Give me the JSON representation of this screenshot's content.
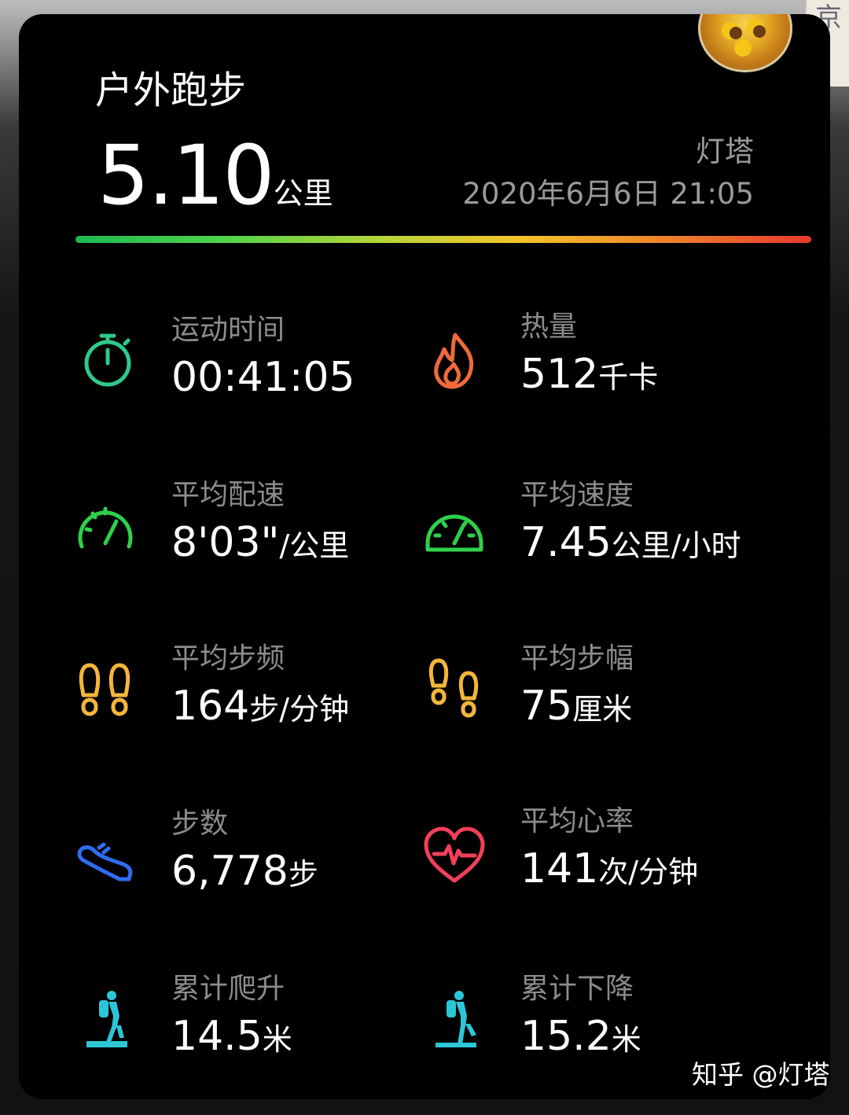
{
  "header": {
    "title": "户外跑步",
    "distance_value": "5.10",
    "distance_unit": "公里",
    "location": "灯塔",
    "datetime": "2020年6月6日 21:05"
  },
  "stats": [
    {
      "label": "运动时间",
      "value": "00:41:05",
      "unit": "",
      "icon": "stopwatch-icon",
      "color": "#2fc98b"
    },
    {
      "label": "热量",
      "value": "512",
      "unit": "千卡",
      "icon": "flame-icon",
      "color": "#f06a3c"
    },
    {
      "label": "平均配速",
      "value": "8'03\"",
      "unit": "/公里",
      "icon": "pace-gauge-icon",
      "color": "#2fd04b"
    },
    {
      "label": "平均速度",
      "value": "7.45",
      "unit": "公里/小时",
      "icon": "speedometer-icon",
      "color": "#2fd04b"
    },
    {
      "label": "平均步频",
      "value": "164",
      "unit": "步/分钟",
      "icon": "footprints-icon",
      "color": "#f4b63a"
    },
    {
      "label": "平均步幅",
      "value": "75",
      "unit": "厘米",
      "icon": "footprints-stride-icon",
      "color": "#f4b63a"
    },
    {
      "label": "步数",
      "value": "6,778",
      "unit": "步",
      "icon": "shoe-icon",
      "color": "#2f6cf0"
    },
    {
      "label": "平均心率",
      "value": "141",
      "unit": "次/分钟",
      "icon": "heart-rate-icon",
      "color": "#f0405a"
    },
    {
      "label": "累计爬升",
      "value": "14.5",
      "unit": "米",
      "icon": "hiker-climb-icon",
      "color": "#2cc7d6"
    },
    {
      "label": "累计下降",
      "value": "15.2",
      "unit": "米",
      "icon": "hiker-descend-icon",
      "color": "#2cc7d6"
    }
  ],
  "watermark": "知乎 @灯塔",
  "corner_stamp": "京",
  "colors": {
    "card_background": "#000000",
    "label": "#8c8c8c",
    "value": "#ffffff"
  }
}
